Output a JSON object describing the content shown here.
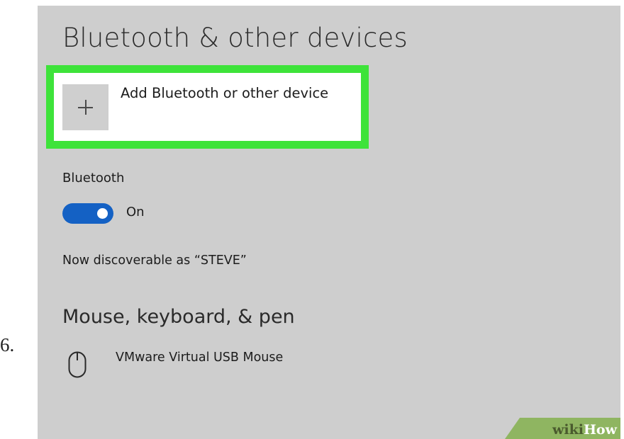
{
  "step": {
    "number": "6."
  },
  "window": {
    "title": "Bluetooth & other devices"
  },
  "add_device": {
    "label": "Add Bluetooth or other device",
    "icon": "plus-icon"
  },
  "bluetooth": {
    "section_label": "Bluetooth",
    "toggle_on": true,
    "toggle_state": "On"
  },
  "discoverable": {
    "text": "Now discoverable as “STEVE”"
  },
  "mouse_section": {
    "heading": "Mouse, keyboard, & pen",
    "devices": [
      {
        "name": "VMware Virtual USB Mouse",
        "icon": "mouse-icon"
      }
    ]
  },
  "watermark": {
    "wiki": "wiki",
    "how": "How"
  },
  "colors": {
    "panel_background": "#cecece",
    "highlight_border": "#3ee33a",
    "toggle_accent": "#1461c4",
    "watermark_band": "#8fb561"
  }
}
